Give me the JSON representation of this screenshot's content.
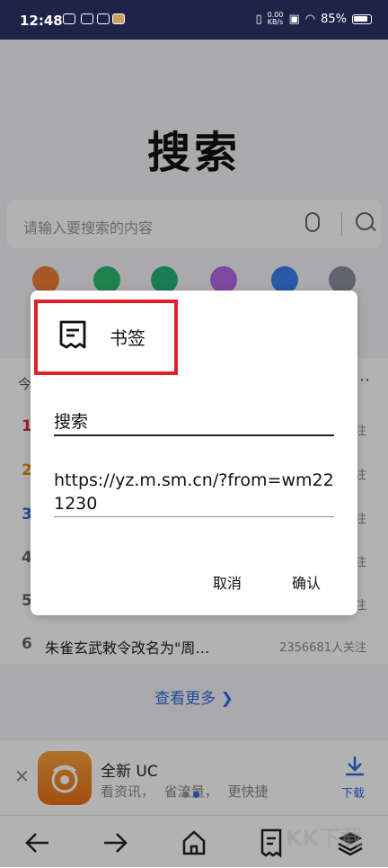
{
  "status_bar": {
    "time": "12:48",
    "net_speed_value": "0.00",
    "net_speed_unit": "KB/s",
    "battery": "85%"
  },
  "page": {
    "title": "搜索",
    "search_placeholder": "请输入要搜索的内容",
    "hot_header": "今",
    "hot_more_icon": "⋯",
    "hot_list": [
      {
        "rank": "1",
        "color": "#e2322b",
        "follow": "注"
      },
      {
        "rank": "2",
        "color": "#f08a24",
        "follow": "注"
      },
      {
        "rank": "3",
        "color": "#2f6be0",
        "follow": "注"
      },
      {
        "rank": "4",
        "color": "#666666",
        "follow": "注"
      },
      {
        "rank": "5",
        "color": "#666666",
        "follow": "注"
      },
      {
        "rank": "6",
        "color": "#666666",
        "text": "朱雀玄武敕令改名为\"周…",
        "follow": "2356681人关注"
      }
    ],
    "more_link": "查看更多 ❯"
  },
  "ad": {
    "close": "✕",
    "app_name": "全新 UC",
    "tagline": "看资讯， 省流量， 更快捷",
    "download_label": "下载"
  },
  "dialog": {
    "title": "书签",
    "name_value": "搜索",
    "url_value": "https://yz.m.sm.cn/?from=wm221230",
    "cancel_label": "取消",
    "confirm_label": "确认"
  },
  "watermark": "KK下载",
  "colors": {
    "accent": "#2f6be0",
    "status_bg": "#1f2348",
    "highlight": "#e0202a"
  }
}
